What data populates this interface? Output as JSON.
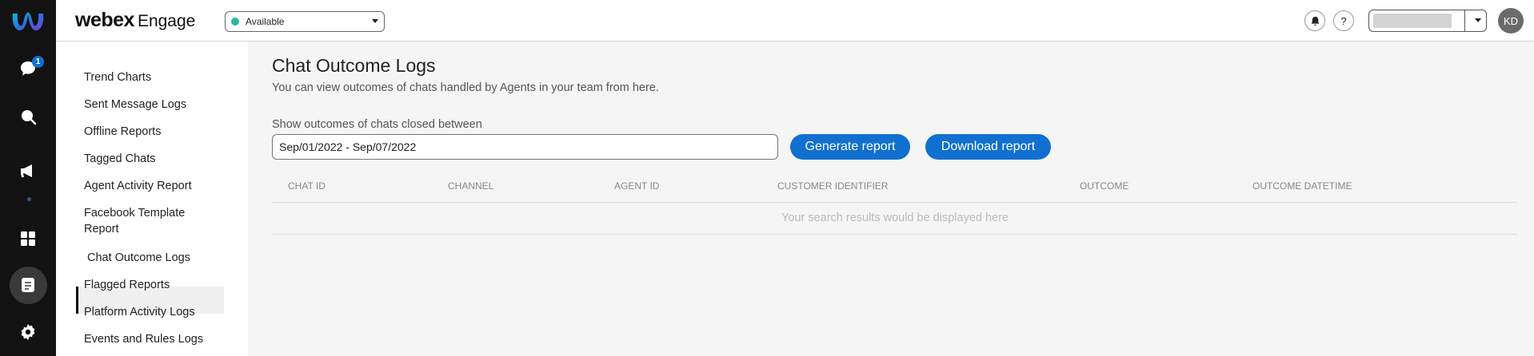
{
  "rail": {
    "chat_badge": "1",
    "icons": [
      "webex-logo-icon",
      "chat-icon",
      "search-icon",
      "megaphone-icon",
      "dashboard-icon",
      "reports-icon",
      "settings-icon"
    ]
  },
  "header": {
    "brand_webex": "webex",
    "brand_engage": "Engage",
    "status": "Available",
    "help": "?",
    "avatar": "KD"
  },
  "subnav": {
    "items": [
      "Trend Charts",
      "Sent Message Logs",
      "Offline Reports",
      "Tagged Chats",
      "Agent Activity Report",
      "Facebook Template Report",
      "Chat Outcome Logs",
      "Flagged Reports",
      "Platform Activity Logs",
      "Events and Rules Logs"
    ],
    "active": "Chat Outcome Logs"
  },
  "main": {
    "title": "Chat Outcome Logs",
    "subtitle": "You can view outcomes of chats handled by Agents in your team from here.",
    "range_label": "Show outcomes of chats closed between",
    "range_value": "Sep/01/2022 - Sep/07/2022",
    "generate_label": "Generate report",
    "download_label": "Download report",
    "columns": [
      "CHAT ID",
      "CHANNEL",
      "AGENT ID",
      "CUSTOMER IDENTIFIER",
      "OUTCOME",
      "OUTCOME DATETIME"
    ],
    "empty_message": "Your search results would be displayed here"
  },
  "colors": {
    "accent": "#1170cf",
    "status_available": "#2cb6a6",
    "rail_bg": "#121212"
  }
}
